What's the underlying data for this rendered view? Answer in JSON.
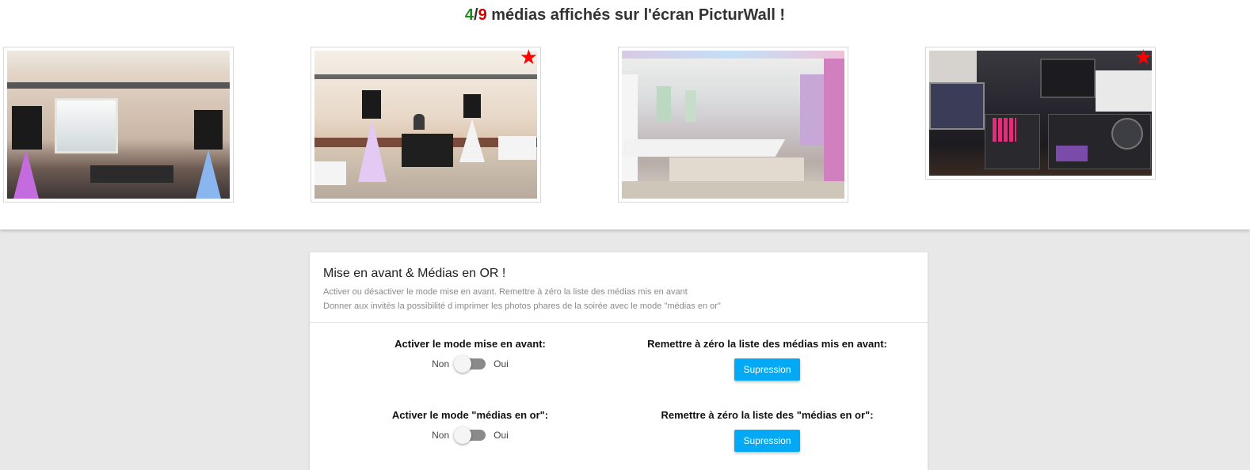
{
  "header": {
    "shown_count": "4",
    "separator": "/",
    "total_count": "9",
    "text": " médias affichés sur l'écran PicturWall !",
    "shown_color": "#1b8a1b",
    "total_color": "#d40000"
  },
  "media": [
    {
      "name": "salle-avec-dj-light",
      "starred": false
    },
    {
      "name": "dj-stand-salle",
      "starred": true,
      "star_icon": "★"
    },
    {
      "name": "salle-tables-banquet",
      "starred": false
    },
    {
      "name": "materiel-dj",
      "starred": true,
      "star_icon": "★"
    }
  ],
  "panel": {
    "title": "Mise en avant & Médias en OR !",
    "subtitle_1": "Activer ou désactiver le mode mise en avant. Remettre à zéro la liste des médias mis en avant",
    "subtitle_2": "Donner aux invités la possibilité d imprimer les photos phares de la soirée avec le mode \"médias en or\"",
    "highlight_mode": {
      "label": "Activer le mode mise en avant:",
      "off": "Non",
      "on": "Oui",
      "enabled": false
    },
    "highlight_reset": {
      "label": "Remettre à zéro la liste des médias mis en avant:",
      "button": "Supression"
    },
    "gold_mode": {
      "label": "Activer le mode \"médias en or\":",
      "off": "Non",
      "on": "Oui",
      "enabled": false
    },
    "gold_reset": {
      "label": "Remettre à zéro la liste des \"médias en or\":",
      "button": "Supression"
    },
    "accent_color": "#03a9f4"
  }
}
